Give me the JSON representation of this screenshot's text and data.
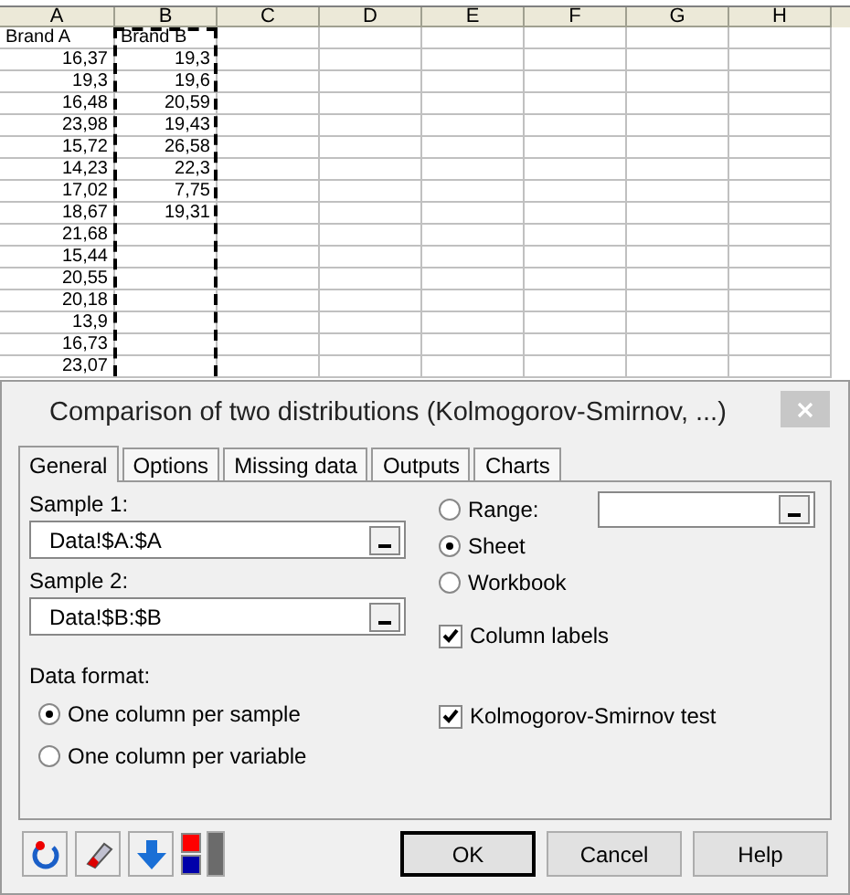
{
  "spreadsheet": {
    "columns": [
      {
        "label": "A",
        "marked": false
      },
      {
        "label": "B",
        "marked": true
      },
      {
        "label": "C",
        "marked": false
      },
      {
        "label": "D",
        "marked": false
      },
      {
        "label": "E",
        "marked": false
      },
      {
        "label": "F",
        "marked": false
      },
      {
        "label": "G",
        "marked": false
      },
      {
        "label": "H",
        "marked": false
      }
    ],
    "rows": [
      [
        "Brand A",
        "Brand B"
      ],
      [
        "16,37",
        "19,3"
      ],
      [
        "19,3",
        "19,6"
      ],
      [
        "16,48",
        "20,59"
      ],
      [
        "23,98",
        "19,43"
      ],
      [
        "15,72",
        "26,58"
      ],
      [
        "14,23",
        "22,3"
      ],
      [
        "17,02",
        "7,75"
      ],
      [
        "18,67",
        "19,31"
      ],
      [
        "21,68"
      ],
      [
        "15,44"
      ],
      [
        "20,55"
      ],
      [
        "20,18"
      ],
      [
        "13,9"
      ],
      [
        "16,73"
      ],
      [
        "23,07"
      ]
    ]
  },
  "dialog": {
    "title": "Comparison of two distributions (Kolmogorov-Smirnov, ...)",
    "tabs": [
      {
        "label": "General",
        "selected": true
      },
      {
        "label": "Options",
        "selected": false
      },
      {
        "label": "Missing data",
        "selected": false
      },
      {
        "label": "Outputs",
        "selected": false
      },
      {
        "label": "Charts",
        "selected": false
      }
    ],
    "samples": [
      {
        "label": "Sample 1:",
        "value": "Data!$A:$A"
      },
      {
        "label": "Sample 2:",
        "value": "Data!$B:$B"
      }
    ],
    "scope": [
      {
        "label": "Range:",
        "selected": false
      },
      {
        "label": "Sheet",
        "selected": true
      },
      {
        "label": "Workbook",
        "selected": false
      }
    ],
    "column_labels": {
      "label": "Column labels",
      "checked": true
    },
    "data_format": {
      "label": "Data format:",
      "options": [
        {
          "label": "One column per sample",
          "selected": true
        },
        {
          "label": "One column per variable",
          "selected": false
        }
      ]
    },
    "ks_test": {
      "label": "Kolmogorov-Smirnov test",
      "checked": true
    },
    "buttons": [
      "OK",
      "Cancel",
      "Help"
    ]
  }
}
